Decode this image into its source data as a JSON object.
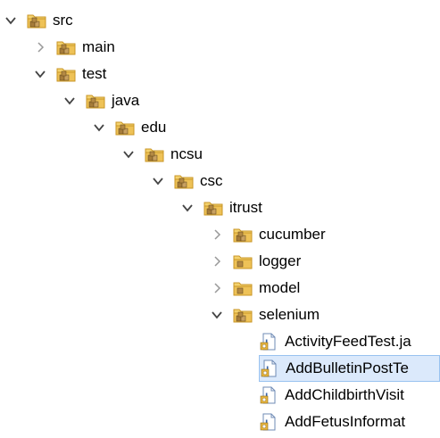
{
  "tree": {
    "nodes": [
      {
        "label": "src",
        "depth": 0,
        "icon": "package-folder-icon",
        "twisty": "expanded",
        "selected": false
      },
      {
        "label": "main",
        "depth": 1,
        "icon": "package-folder-icon",
        "twisty": "collapsed",
        "selected": false
      },
      {
        "label": "test",
        "depth": 1,
        "icon": "package-folder-icon",
        "twisty": "expanded",
        "selected": false
      },
      {
        "label": "java",
        "depth": 2,
        "icon": "package-folder-icon",
        "twisty": "expanded",
        "selected": false
      },
      {
        "label": "edu",
        "depth": 3,
        "icon": "package-folder-icon",
        "twisty": "expanded",
        "selected": false
      },
      {
        "label": "ncsu",
        "depth": 4,
        "icon": "package-folder-icon",
        "twisty": "expanded",
        "selected": false
      },
      {
        "label": "csc",
        "depth": 5,
        "icon": "package-folder-icon",
        "twisty": "expanded",
        "selected": false
      },
      {
        "label": "itrust",
        "depth": 6,
        "icon": "package-folder-icon",
        "twisty": "expanded",
        "selected": false
      },
      {
        "label": "cucumber",
        "depth": 7,
        "icon": "package-folder-icon",
        "twisty": "collapsed",
        "selected": false
      },
      {
        "label": "logger",
        "depth": 7,
        "icon": "folder-icon",
        "twisty": "collapsed",
        "selected": false
      },
      {
        "label": "model",
        "depth": 7,
        "icon": "folder-icon",
        "twisty": "collapsed",
        "selected": false
      },
      {
        "label": "selenium",
        "depth": 7,
        "icon": "package-folder-icon",
        "twisty": "expanded",
        "selected": false
      },
      {
        "label": "ActivityFeedTest.ja",
        "depth": 8,
        "icon": "java-file-icon",
        "twisty": "none",
        "selected": false
      },
      {
        "label": "AddBulletinPostTe",
        "depth": 8,
        "icon": "java-file-icon",
        "twisty": "none",
        "selected": true
      },
      {
        "label": "AddChildbirthVisit",
        "depth": 8,
        "icon": "java-file-icon",
        "twisty": "none",
        "selected": false
      },
      {
        "label": "AddFetusInformat",
        "depth": 8,
        "icon": "java-file-icon",
        "twisty": "none",
        "selected": false
      }
    ]
  },
  "colors": {
    "selection_bg": "#dbe9fb",
    "selection_border": "#99c2f0",
    "twisty": "#555555",
    "folder": "#e8b53c"
  }
}
